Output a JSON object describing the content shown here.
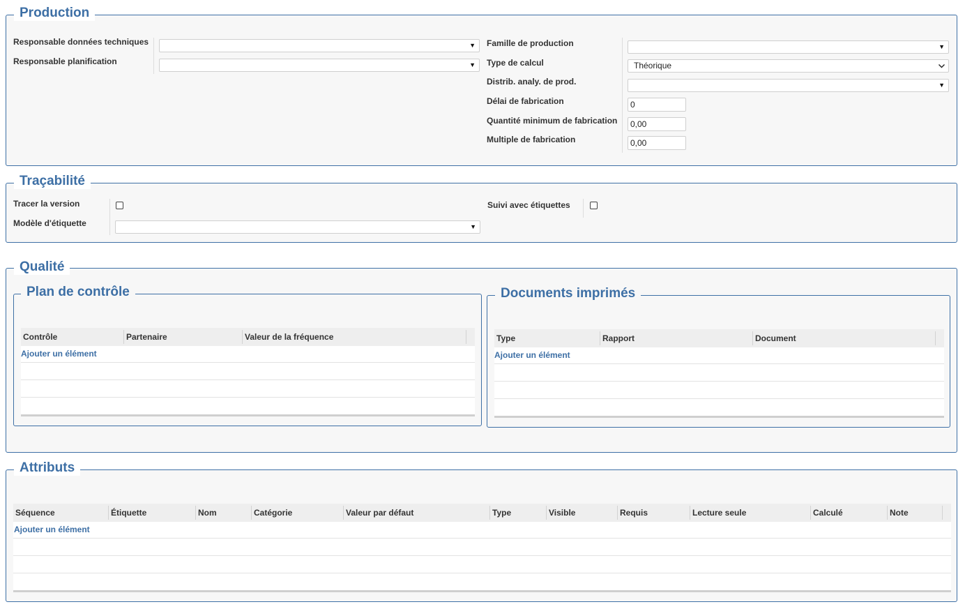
{
  "production": {
    "legend": "Production",
    "fields": {
      "resp_donnees_label": "Responsable données techniques",
      "resp_planif_label": "Responsable planification",
      "famille_label": "Famille de production",
      "type_calcul_label": "Type de calcul",
      "type_calcul_value": "Théorique",
      "distrib_label": "Distrib. analy. de prod.",
      "delai_label": "Délai de fabrication",
      "delai_value": "0",
      "qte_min_label": "Quantité minimum de fabrication",
      "qte_min_value": "0,00",
      "multiple_label": "Multiple de fabrication",
      "multiple_value": "0,00"
    }
  },
  "tracabilite": {
    "legend": "Traçabilité",
    "tracer_label": "Tracer la version",
    "modele_label": "Modèle d'étiquette",
    "suivi_label": "Suivi avec étiquettes"
  },
  "qualite": {
    "legend": "Qualité",
    "plan": {
      "legend": "Plan de contrôle",
      "columns": [
        "Contrôle",
        "Partenaire",
        "Valeur de la fréquence"
      ],
      "add_label": "Ajouter un élément"
    },
    "documents": {
      "legend": "Documents imprimés",
      "columns": [
        "Type",
        "Rapport",
        "Document"
      ],
      "add_label": "Ajouter un élément"
    }
  },
  "attributs": {
    "legend": "Attributs",
    "columns": [
      "Séquence",
      "Étiquette",
      "Nom",
      "Catégorie",
      "Valeur par défaut",
      "Type",
      "Visible",
      "Requis",
      "Lecture seule",
      "Calculé",
      "Note"
    ],
    "add_label": "Ajouter un élément"
  },
  "colors": {
    "accent": "#3d6fa5",
    "panel": "#f7f7f7",
    "header": "#eeeeee"
  },
  "icons": {
    "dropdown": "triangle-down-icon",
    "chevron": "chevron-down-icon"
  }
}
